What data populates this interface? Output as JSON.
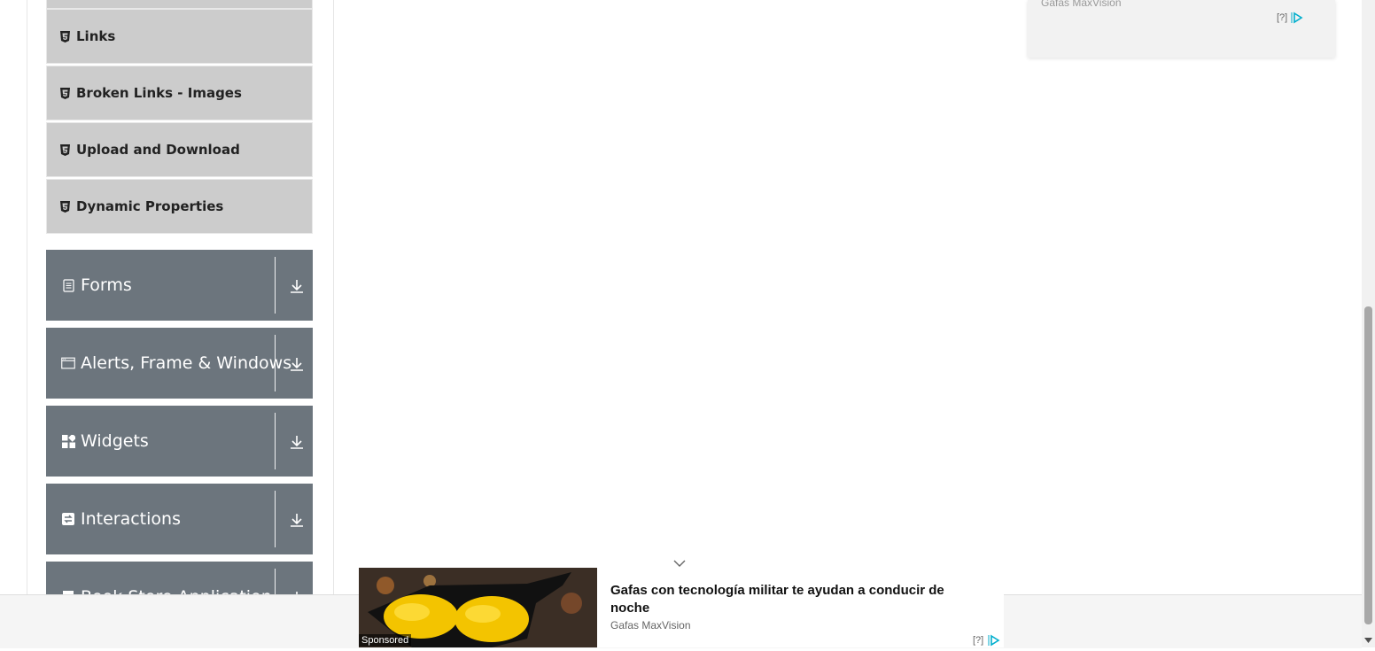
{
  "sidebar": {
    "sub_items": [
      {
        "label": "Links",
        "icon": "html5-icon"
      },
      {
        "label": "Broken Links - Images",
        "icon": "html5-icon"
      },
      {
        "label": "Upload and Download",
        "icon": "html5-icon"
      },
      {
        "label": "Dynamic Properties",
        "icon": "html5-icon"
      }
    ],
    "groups": [
      {
        "label": "Forms",
        "icon": "document-icon"
      },
      {
        "label": "Alerts, Frame & Windows",
        "icon": "window-icon"
      },
      {
        "label": "Widgets",
        "icon": "widgets-icon"
      },
      {
        "label": "Interactions",
        "icon": "swap-icon"
      },
      {
        "label": "Book Store Application",
        "icon": "book-icon"
      }
    ]
  },
  "ad_top": {
    "source": "Gafas MaxVision",
    "help": "[?]"
  },
  "ad_bottom": {
    "sponsored": "Sponsored",
    "title": "Gafas con tecnología militar te ayudan a conducir de noche",
    "source": "Gafas MaxVision",
    "help": "[?]"
  },
  "colors": {
    "group_bg": "#6c757d",
    "sub_item_bg": "#cccccc",
    "ad_choices": "#00aecd"
  }
}
